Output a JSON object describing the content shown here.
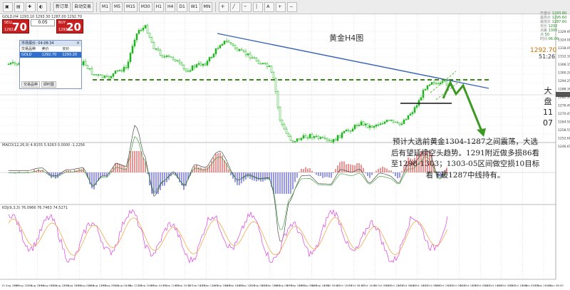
{
  "toolbar": {
    "items": [
      "新订单",
      "自动交易"
    ],
    "timeframes": [
      "M1",
      "M5",
      "M15",
      "M30",
      "H1",
      "H4",
      "D1",
      "W1",
      "MN"
    ]
  },
  "symbol_header": "GOLD,H4  1293.10 1293.30 1287.00 1292.70",
  "trade_panel": {
    "sell_label": "SELL",
    "buy_label": "BUY",
    "lot": "0.05",
    "sell_price_small": "1292",
    "sell_price_big": "70",
    "buy_price_small": "1293",
    "buy_price_big": "20"
  },
  "market_watch": {
    "title": "市场报价: 04:08:34",
    "columns": [
      "交易品种",
      "卖价",
      "买价"
    ],
    "rows": [
      {
        "symbol": "GOLD",
        "bid": "1292.70",
        "ask": "1293.20"
      }
    ],
    "tabs": [
      "交易品种",
      "即时图"
    ]
  },
  "right_info": [
    {
      "label": "开盘价",
      "value": "1293.80"
    },
    {
      "label": "最高价",
      "value": "1295.60"
    },
    {
      "label": "最低价",
      "value": "1287.60"
    },
    {
      "label": "买价",
      "value": "1292"
    },
    {
      "label": "点差",
      "value": "1300"
    },
    {
      "label": "点",
      "value": "50"
    },
    {
      "label": "时间",
      "value": "06:00"
    }
  ],
  "current_price": "1292.70",
  "countdown": "51:26",
  "chart_title": "黄金H4图",
  "side_note": "大 盘 11 07",
  "analysis_text": "预计大选前黄金1304-1287之间震荡，大选后有望延续空头趋势。1291附近做多损86看至1298-1303；1303-05区间做空损10目标看下破1287中线持有。",
  "indicators": {
    "macd_label": "MACD(12,26,9) 4.8155 5.9263 0.0000 -1.2256",
    "kdj_label": "KDJ(9,3,3) 76.0966 76.7463 74.5271"
  },
  "price_axis": [
    "1329.95",
    "1324.00",
    "1318.05",
    "1312.10",
    "1306.15",
    "1300.20",
    "1294.25",
    "1288.30",
    "1282.35",
    "1276.40",
    "1270.45",
    "1264.50",
    "1258.55",
    "1252.60",
    "1246.65"
  ],
  "time_axis": [
    "15 Aug 2016",
    "16 Aug 12:00",
    "17 Aug 20:00",
    "19 Aug 04:00",
    "22 Aug 12:00",
    "23 Aug 20:00",
    "25 Aug 04:00",
    "26 Aug 12:00",
    "29 Aug 20:00",
    "31 Aug 04:00",
    "1 Sep 12:00",
    "2 Sep 20:00",
    "6 Sep 04:00",
    "7 Sep 12:00",
    "8 Sep 20:00",
    "12 Sep 04:00",
    "13 Sep 12:00",
    "14 Sep 20:00",
    "16 Sep 04:00",
    "19 Sep 12:00",
    "21 Sep 08:00",
    "22 Sep 16:00",
    "26 Sep 08:00",
    "27 Sep 16:00",
    "29 Sep 08:00",
    "30 Sep 16:00",
    "3 Oct 08:00",
    "4 Oct 16:00",
    "6 Oct 08:00",
    "7 Oct 16:00",
    "10 Oct 08:00",
    "11 Oct 16:00",
    "13 Oct 08:00",
    "14 Oct 16:00",
    "17 Oct 08:00",
    "18 Oct 16:00",
    "20 Oct 08:00",
    "21 Oct 16:00",
    "25 Oct 08:00",
    "26 Oct 16:00",
    "28 Oct 08:00",
    "31 Oct 16:00",
    "2 Nov 08:00",
    "3 Nov 16:00",
    "4 Nov 08:00"
  ],
  "colors": {
    "bull": "#1fb31f",
    "bear": "#1fb31f",
    "trendline": "#3a64b8",
    "support": "#3a8a1a",
    "arrow": "#3c9a22",
    "macd_up": "#e06666",
    "macd_down": "#6b6bd8",
    "kdj_k": "#e040e0",
    "kdj_d": "#f0a030"
  }
}
